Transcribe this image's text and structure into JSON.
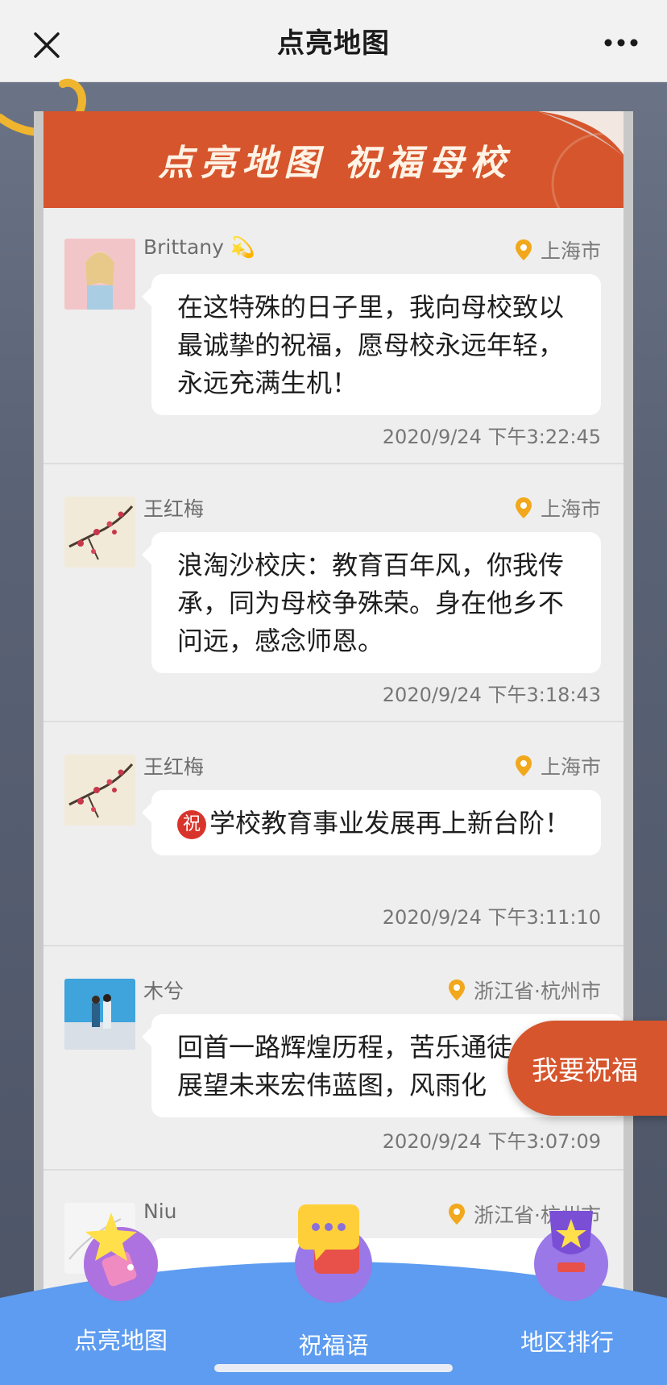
{
  "nav": {
    "title": "点亮地图"
  },
  "banner": {
    "title": "点亮地图 祝福母校"
  },
  "messages": [
    {
      "name": "Brittany 💫",
      "location": "上海市",
      "text": "在这特殊的日子里，我向母校致以最诚挚的祝福，愿母校永远年轻，永远充满生机！",
      "time": "2020/9/24 下午3:22:45"
    },
    {
      "name": "王红梅",
      "location": "上海市",
      "text": "浪淘沙校庆：教育百年风，你我传承，同为母校争殊荣。身在他乡不问远，感念师恩。",
      "time": "2020/9/24 下午3:18:43"
    },
    {
      "name": "王红梅",
      "location": "上海市",
      "badge": "祝",
      "text": "学校教育事业发展再上新台阶！",
      "time": "2020/9/24 下午3:11:10"
    },
    {
      "name": "木兮",
      "location": "浙江省·杭州市",
      "text": "回首一路辉煌历程，苦乐通徒展望未来宏伟蓝图，风雨化",
      "time": "2020/9/24 下午3:07:09"
    },
    {
      "name": "Niu",
      "location": "浙江省·杭州市",
      "text": "",
      "time": ""
    }
  ],
  "wish_button": "我要祝福",
  "tabs": [
    {
      "label": "点亮地图",
      "icon": "star-map-icon"
    },
    {
      "label": "祝福语",
      "icon": "chat-bubble-icon"
    },
    {
      "label": "地区排行",
      "icon": "trophy-icon"
    }
  ],
  "colors": {
    "accent": "#d6552c",
    "tabbar": "#5d9cf0",
    "pin": "#f2a81d"
  }
}
